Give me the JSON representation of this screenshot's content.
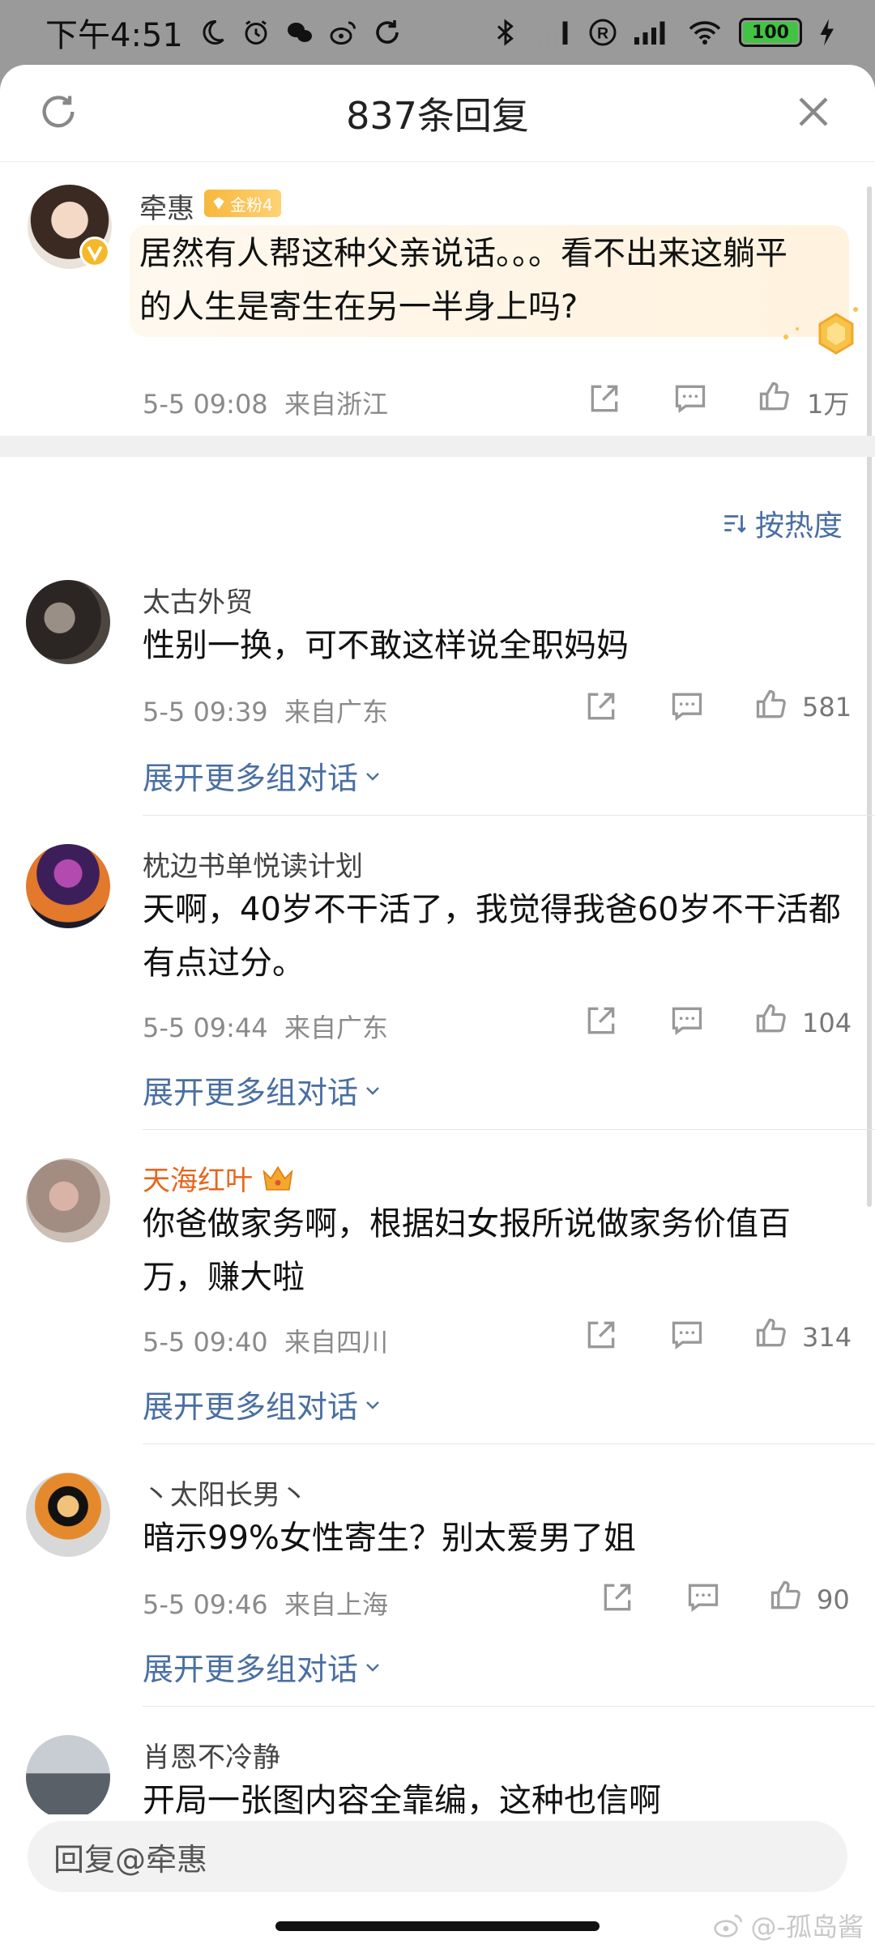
{
  "status_bar": {
    "time": "下午4:51",
    "battery": "100",
    "icons": [
      "moon-icon",
      "alarm-icon",
      "wechat-icon",
      "weibo-icon",
      "sync-icon",
      "bluetooth-icon",
      "signal-icon",
      "registered-icon",
      "signal-icon",
      "wifi-icon",
      "battery-icon",
      "charging-icon"
    ]
  },
  "header": {
    "title": "837条回复",
    "refresh_icon": "refresh-icon",
    "close_icon": "close-icon"
  },
  "root_comment": {
    "author": "牵惠",
    "badge": "金粉4",
    "text_line1": "居然有人帮这种父亲说话。。。看不出来这躺平",
    "text_line2": "的人生是寄生在另一半身上吗?",
    "time": "5-5 09:08",
    "location": "来自浙江",
    "likes": "1万",
    "verified": true
  },
  "sort_label": "按热度",
  "expand_label": "展开更多组对话",
  "comments": [
    {
      "author": "太古外贸",
      "text_line1": "性别一换，可不敢这样说全职妈妈",
      "text_line2": "",
      "time": "5-5 09:39",
      "location": "来自广东",
      "likes": "581"
    },
    {
      "author": "枕边书单悦读计划",
      "text_line1": "天啊，40岁不干活了，我觉得我爸60岁不干活都",
      "text_line2": "有点过分。",
      "time": "5-5 09:44",
      "location": "来自广东",
      "likes": "104"
    },
    {
      "author": "天海红叶",
      "text_line1": "你爸做家务啊，根据妇女报所说做家务价值百",
      "text_line2": "万，赚大啦",
      "time": "5-5 09:40",
      "location": "来自四川",
      "likes": "314",
      "vip": true
    },
    {
      "author": "丶太阳长男丶",
      "text_line1": "暗示99%女性寄生？别太爱男了姐",
      "text_line2": "",
      "time": "5-5 09:46",
      "location": "来自上海",
      "likes": "90"
    },
    {
      "author": "肖恩不冷静",
      "text_line1": "开局一张图内容全靠编，这种也信啊",
      "text_line2": ""
    }
  ],
  "reply_input": {
    "placeholder": "回复@牵惠"
  },
  "watermark": "@-孤岛酱",
  "colors": {
    "link_blue": "#4a6fa1",
    "vip_name_orange": "#e8661b",
    "gold_badge": "#f6b73c",
    "battery_green": "#43c343"
  }
}
